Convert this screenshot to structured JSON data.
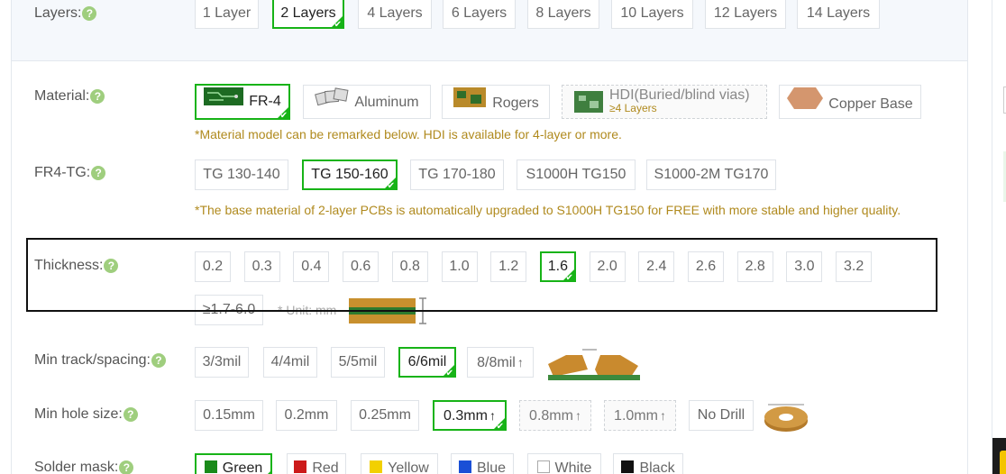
{
  "layers": {
    "label": "Layers:",
    "options": [
      "1 Layer",
      "2 Layers",
      "4 Layers",
      "6 Layers",
      "8 Layers",
      "10 Layers",
      "12 Layers",
      "14 Layers"
    ],
    "selected": "2 Layers"
  },
  "material": {
    "label": "Material:",
    "options": {
      "fr4": "FR-4",
      "aluminum": "Aluminum",
      "rogers": "Rogers",
      "hdi": "HDI(Buried/blind vias)",
      "hdi_sub": "≥4 Layers",
      "copper": "Copper Base"
    },
    "selected": "FR-4",
    "note": "*Material model can be remarked below. HDI is available for 4-layer or more."
  },
  "fr4tg": {
    "label": "FR4-TG:",
    "options": [
      "TG 130-140",
      "TG 150-160",
      "TG 170-180",
      "S1000H TG150",
      "S1000-2M TG170"
    ],
    "selected": "TG 150-160",
    "note": "*The base material of 2-layer PCBs is automatically upgraded to S1000H TG150 for FREE with more stable and higher quality."
  },
  "thickness": {
    "label": "Thickness:",
    "options": [
      "0.2",
      "0.3",
      "0.4",
      "0.6",
      "0.8",
      "1.0",
      "1.2",
      "1.6",
      "2.0",
      "2.4",
      "2.6",
      "2.8",
      "3.0",
      "3.2"
    ],
    "selected": "1.6",
    "custom": "≥1.7-6.0",
    "unit": "* Unit: mm"
  },
  "track": {
    "label": "Min track/spacing:",
    "options": [
      "3/3mil",
      "4/4mil",
      "5/5mil",
      "6/6mil",
      "8/8mil"
    ],
    "selected": "6/6mil"
  },
  "hole": {
    "label": "Min hole size:",
    "options": [
      "0.15mm",
      "0.2mm",
      "0.25mm",
      "0.3mm",
      "0.8mm",
      "1.0mm",
      "No Drill"
    ],
    "selected": "0.3mm"
  },
  "mask": {
    "label": "Solder mask:",
    "options": [
      {
        "name": "Green",
        "color": "#1a8a1a"
      },
      {
        "name": "Red",
        "color": "#cc1a1a"
      },
      {
        "name": "Yellow",
        "color": "#f2d000"
      },
      {
        "name": "Blue",
        "color": "#1a4fd6"
      },
      {
        "name": "White",
        "color": "#ffffff"
      },
      {
        "name": "Black",
        "color": "#111111"
      }
    ],
    "selected": "Green"
  },
  "help_glyph": "?",
  "arrow_glyph": "↑",
  "check_glyph": "✔"
}
